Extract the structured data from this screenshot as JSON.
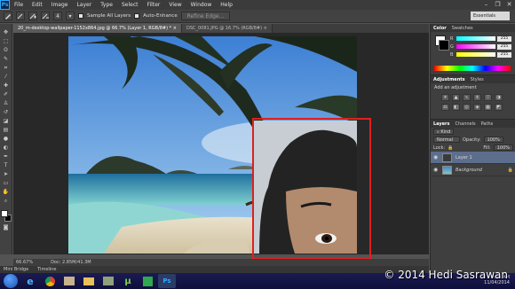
{
  "app": {
    "logo": "Ps"
  },
  "menubar": {
    "items": [
      "File",
      "Edit",
      "Image",
      "Layer",
      "Type",
      "Select",
      "Filter",
      "View",
      "Window",
      "Help"
    ]
  },
  "window_controls": {
    "minimize": "–",
    "restore": "❐",
    "close": "✕"
  },
  "options_bar": {
    "size_value": "4",
    "sample_all_layers": "Sample All Layers",
    "auto_enhance": "Auto-Enhance",
    "refine_edge": "Refine Edge...",
    "workspace": "Essentials"
  },
  "tabs": [
    {
      "label": "20_m-desktop-wallpaper-1152x864.jpg @ 66.7% (Layer 1, RGB/8#) *",
      "close": "×"
    },
    {
      "label": "DSC_0081.JPG @ 16.7% (RGB/8#)",
      "close": "×"
    }
  ],
  "status": {
    "zoom": "66.67%",
    "doc": "Doc: 2.85M/41.3M"
  },
  "mini_bridge": {
    "tab1": "Mini Bridge",
    "tab2": "Timeline"
  },
  "color_panel": {
    "tabs": [
      "Color",
      "Swatches"
    ],
    "rows": [
      {
        "label": "R",
        "value": "255"
      },
      {
        "label": "G",
        "value": "255"
      },
      {
        "label": "B",
        "value": "255"
      }
    ]
  },
  "adjustments_panel": {
    "tabs": [
      "Adjustments",
      "Styles"
    ],
    "heading": "Add an adjustment"
  },
  "layers_panel": {
    "tabs": [
      "Layers",
      "Channels",
      "Paths"
    ],
    "kind": "Kind",
    "blend_mode": "Normal",
    "opacity_label": "Opacity:",
    "opacity_value": "100%",
    "lock_label": "Lock:",
    "fill_label": "Fill:",
    "fill_value": "100%",
    "layers": [
      {
        "name": "Layer 1",
        "selected": true
      },
      {
        "name": "Background",
        "selected": false
      }
    ]
  },
  "taskbar": {
    "clock_time": "9:21 AM",
    "clock_date": "11/04/2014"
  },
  "watermark": "© 2014 Hedi Sasrawan",
  "colors": {
    "selection": "#e01f1f",
    "accent": "#31a8ff"
  }
}
